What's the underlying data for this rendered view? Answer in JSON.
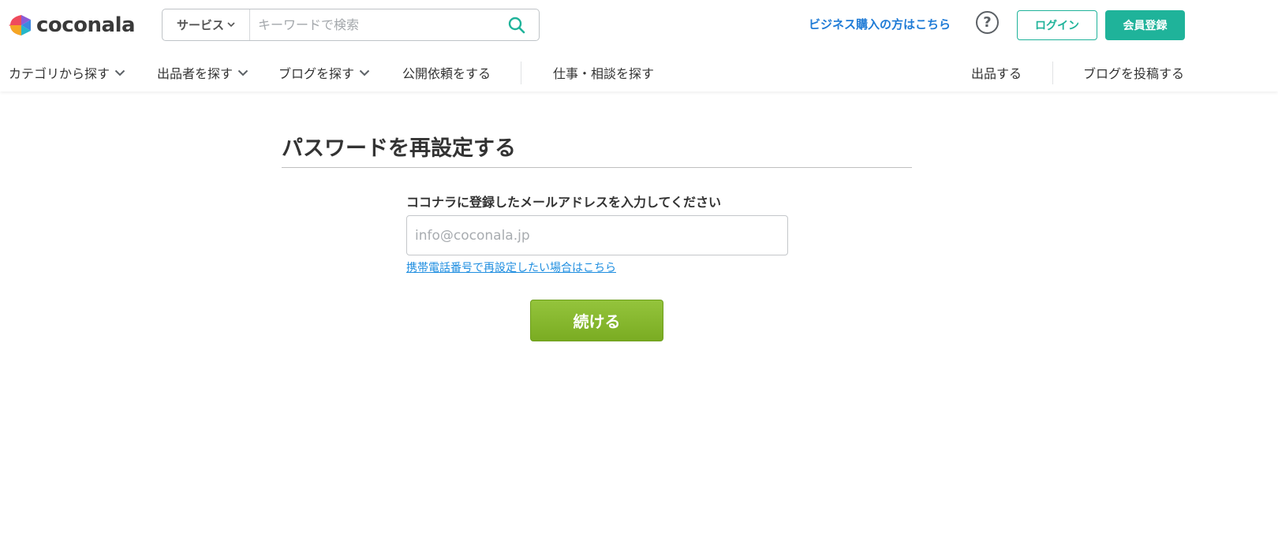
{
  "header": {
    "logo_text": "coconala",
    "search": {
      "category_label": "サービス",
      "placeholder": "キーワードで検索"
    },
    "business_link": "ビジネス購入の方はこちら",
    "help_glyph": "?",
    "login_label": "ログイン",
    "register_label": "会員登録"
  },
  "nav": {
    "items": [
      {
        "label": "カテゴリから探す",
        "has_dropdown": true
      },
      {
        "label": "出品者を探す",
        "has_dropdown": true
      },
      {
        "label": "ブログを探す",
        "has_dropdown": true
      },
      {
        "label": "公開依頼をする",
        "has_dropdown": false
      },
      {
        "label": "仕事・相談を探す",
        "has_dropdown": false
      }
    ],
    "right_items": [
      {
        "label": "出品する"
      },
      {
        "label": "ブログを投稿する"
      }
    ]
  },
  "main": {
    "title": "パスワードを再設定する",
    "email_label": "ココナラに登録したメールアドレスを入力してください",
    "email_placeholder": "info@coconala.jp",
    "email_value": "",
    "phone_link": "携帯電話番号で再設定したい場合はこちら",
    "continue_label": "続ける"
  },
  "colors": {
    "brand_green": "#1fb39a",
    "link_blue": "#1f7bd6",
    "submit_green": "#86b82e"
  }
}
